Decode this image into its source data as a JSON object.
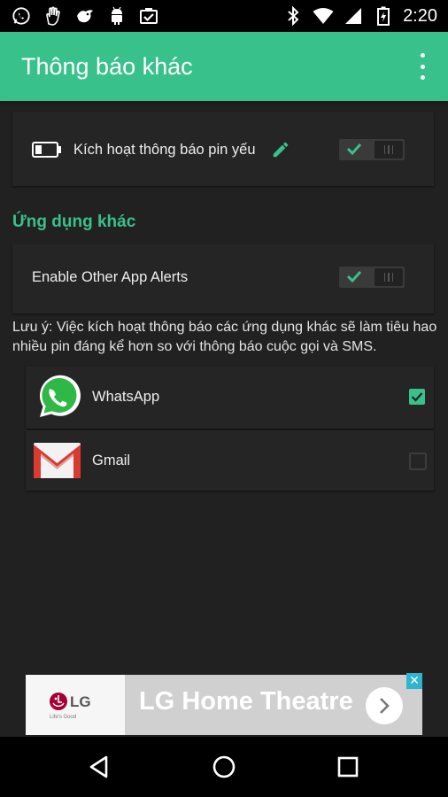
{
  "status_bar": {
    "time": "2:20",
    "left_icons": [
      "whatsapp-icon",
      "hand-icon",
      "bird-icon",
      "android-icon",
      "checklist-icon"
    ],
    "right_icons": [
      "bluetooth-icon",
      "wifi-icon",
      "signal-icon",
      "battery-icon"
    ]
  },
  "app_bar": {
    "title": "Thông báo khác",
    "menu_icon": "more-vert-icon"
  },
  "low_battery": {
    "label": "Kích hoạt thông báo pin yếu",
    "enabled": true
  },
  "other_apps": {
    "section_title": "Ứng dụng khác",
    "enable_label": "Enable Other App Alerts",
    "enabled": true,
    "note": "Lưu ý: Việc kích hoạt thông báo các ứng dụng khác sẽ làm tiêu hao nhiều pin đáng kể hơn so với thông báo cuộc gọi và SMS.",
    "apps": [
      {
        "name": "WhatsApp",
        "checked": true
      },
      {
        "name": "Gmail",
        "checked": false
      }
    ]
  },
  "ad": {
    "brand": "LG",
    "tagline": "Life's Good",
    "text": "LG Home Theatre",
    "close": "✕"
  },
  "colors": {
    "accent": "#39c18c",
    "background": "#212121",
    "card": "#252525"
  }
}
